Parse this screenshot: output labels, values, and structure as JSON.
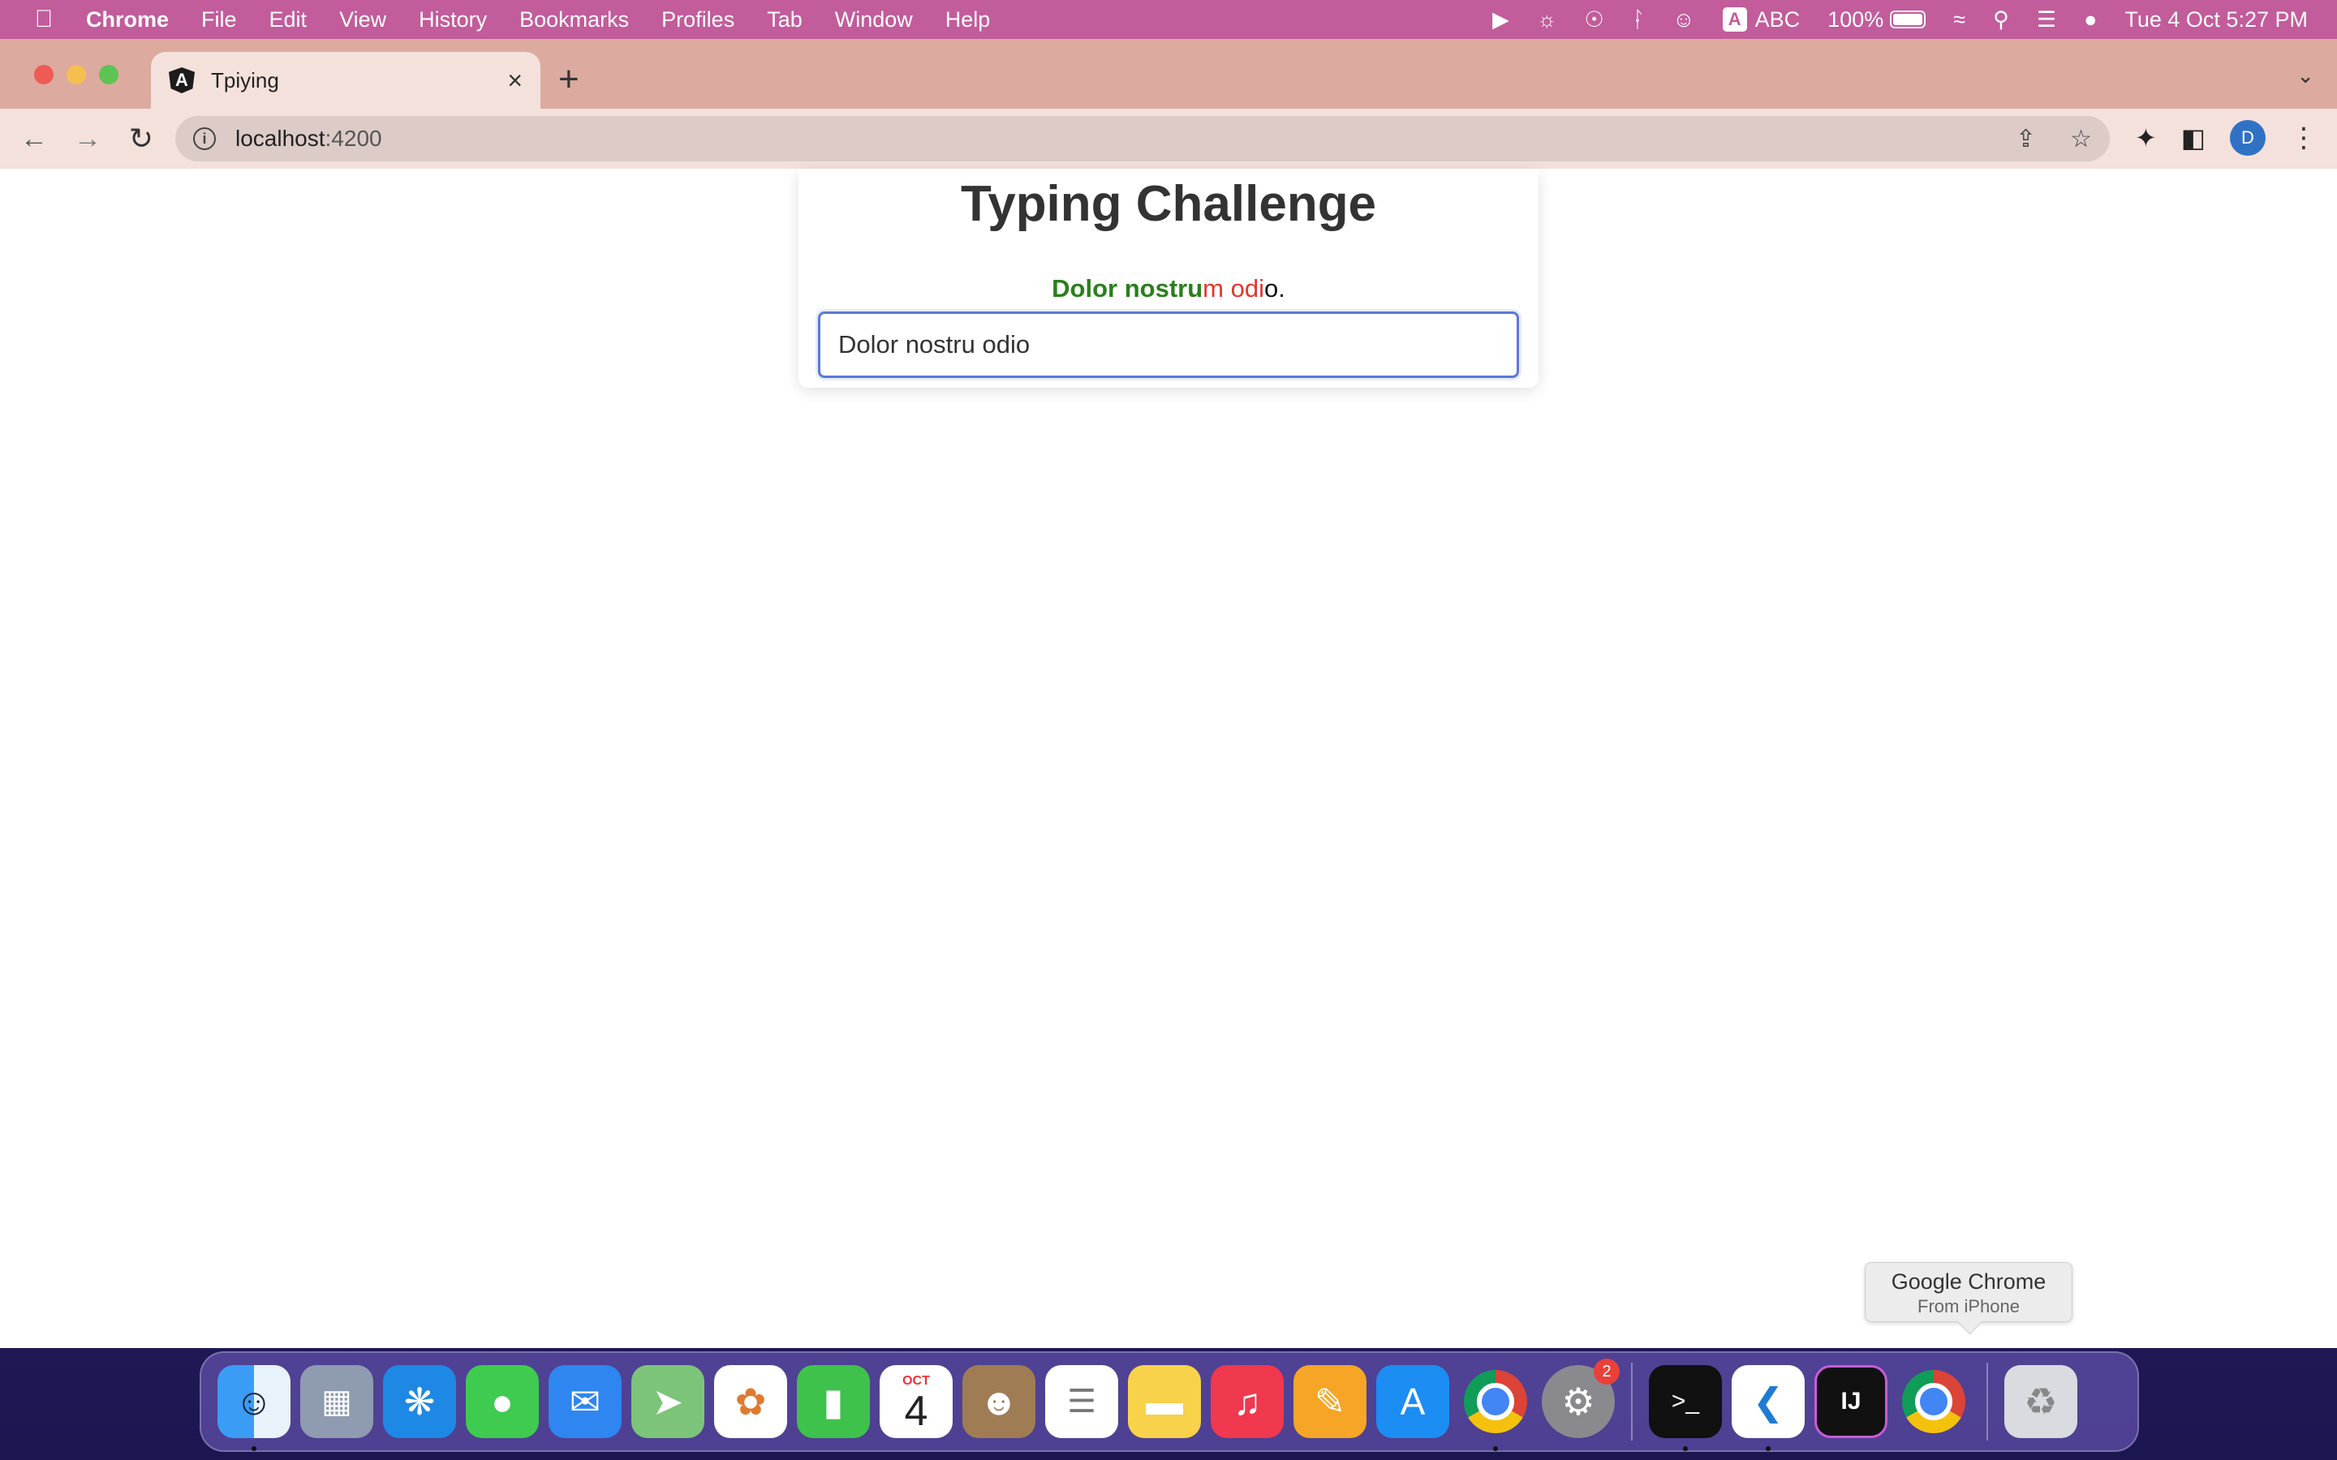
{
  "menubar": {
    "app_name": "Chrome",
    "items": [
      "File",
      "Edit",
      "View",
      "History",
      "Bookmarks",
      "Profiles",
      "Tab",
      "Window",
      "Help"
    ],
    "input_source": "ABC",
    "battery": "100%",
    "datetime": "Tue 4 Oct  5:27 PM"
  },
  "browser": {
    "tab_title": "Tpiying",
    "url_host": "localhost",
    "url_port": ":4200",
    "profile_initial": "D"
  },
  "page": {
    "title": "Typing Challenge",
    "challenge": {
      "correct": "Dolor nostru",
      "wrong": "m odi",
      "pending": "o."
    },
    "input_value": "Dolor nostru odio"
  },
  "tooltip": {
    "title": "Google Chrome",
    "subtitle": "From iPhone"
  },
  "dock": {
    "calendar_month": "OCT",
    "calendar_day": "4",
    "settings_badge": "2",
    "intellij_label": "IJ"
  }
}
